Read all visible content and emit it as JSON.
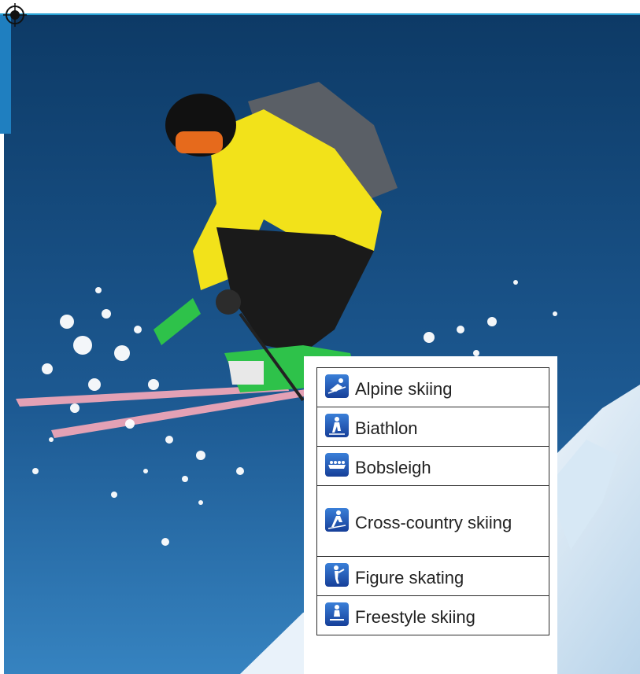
{
  "sports": [
    {
      "name": "Alpine skiing",
      "icon": "alpine-skiing-icon"
    },
    {
      "name": "Biathlon",
      "icon": "biathlon-icon"
    },
    {
      "name": "Bobsleigh",
      "icon": "bobsleigh-icon"
    },
    {
      "name": "Cross-country skiing",
      "icon": "cross-country-skiing-icon"
    },
    {
      "name": "Figure skating",
      "icon": "figure-skating-icon"
    },
    {
      "name": "Freestyle skiing",
      "icon": "freestyle-skiing-icon"
    }
  ],
  "colors": {
    "sky_top": "#0d3a66",
    "sky_bottom": "#2f79b8",
    "accent_rule": "#29a3d6",
    "jacket": "#f2e21a",
    "pictogram_blue": "#1f4fb0"
  }
}
